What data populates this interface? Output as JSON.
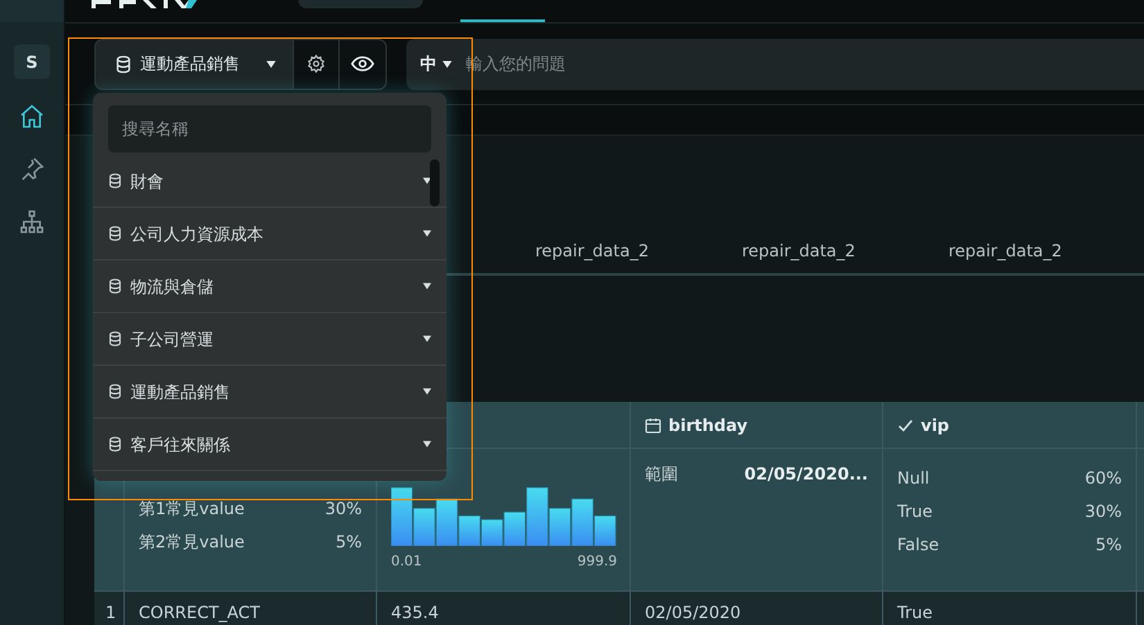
{
  "sidebar": {
    "avatar": "S",
    "items": [
      {
        "kind": "home",
        "selected": true
      },
      {
        "kind": "pin",
        "selected": false
      },
      {
        "kind": "sitemap",
        "selected": false
      }
    ]
  },
  "toolbar": {
    "dataset": "運動產品銷售",
    "language": "中",
    "question_placeholder": "輸入您的問題"
  },
  "dropdown": {
    "search_placeholder": "搜尋名稱",
    "items": [
      {
        "label": "財會"
      },
      {
        "label": "公司人力資源成本"
      },
      {
        "label": "物流與倉儲"
      },
      {
        "label": "子公司營運"
      },
      {
        "label": "運動產品銷售"
      },
      {
        "label": "客戶往來關係"
      }
    ]
  },
  "tabs": [
    "repair_data_2",
    "repair_data_2",
    "repair_data_2"
  ],
  "table": {
    "columns": [
      {
        "kind": "category",
        "stats": [
          {
            "label": "第1常見value",
            "value": "30%"
          },
          {
            "label": "第2常見value",
            "value": "5%"
          }
        ]
      },
      {
        "kind": "numeric",
        "min": "0.01",
        "max": "999.9"
      },
      {
        "kind": "date",
        "name": "birthday",
        "range_label": "範圍",
        "range": "02/05/2020..."
      },
      {
        "kind": "boolean",
        "name": "vip",
        "stats": [
          {
            "label": "Null",
            "value": "60%"
          },
          {
            "label": "True",
            "value": "30%"
          },
          {
            "label": "False",
            "value": "5%"
          }
        ]
      }
    ],
    "rows": [
      {
        "index": "1",
        "cells": [
          "CORRECT_ACT",
          "435.4",
          "02/05/2020",
          "True"
        ]
      }
    ]
  }
}
